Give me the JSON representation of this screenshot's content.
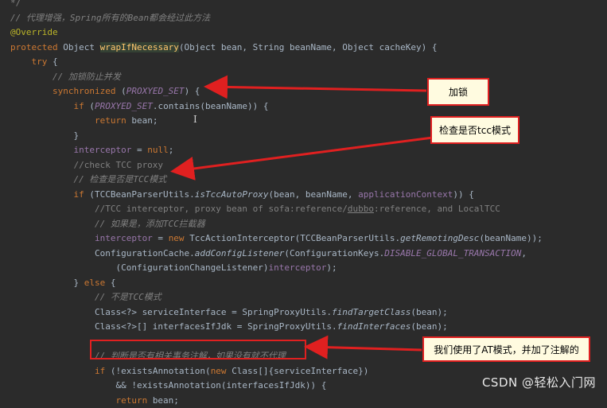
{
  "code_lines": [
    {
      "id": "l0",
      "segs": [
        {
          "c": "cm",
          "t": "*/"
        }
      ]
    },
    {
      "id": "l1",
      "segs": [
        {
          "c": "cmi",
          "t": "// 代理增强，Spring所有的Bean都会经过此方法"
        }
      ]
    },
    {
      "id": "l2",
      "segs": [
        {
          "c": "ann",
          "t": "@Override"
        }
      ]
    },
    {
      "id": "l3",
      "segs": [
        {
          "c": "kw",
          "t": "protected "
        },
        {
          "c": "tok",
          "t": "Object "
        },
        {
          "c": "fnh",
          "t": "wrapIfNecessary"
        },
        {
          "c": "tok",
          "t": "(Object bean, String beanName, Object cacheKey) {"
        }
      ]
    },
    {
      "id": "l4",
      "segs": [
        {
          "c": "kw",
          "t": "    try "
        },
        {
          "c": "tok",
          "t": "{"
        }
      ]
    },
    {
      "id": "l5",
      "segs": [
        {
          "c": "cmi",
          "t": "        // 加锁防止并发"
        }
      ]
    },
    {
      "id": "l6",
      "segs": [
        {
          "c": "kw",
          "t": "        synchronized "
        },
        {
          "c": "tok",
          "t": "("
        },
        {
          "c": "cst",
          "t": "PROXYED_SET"
        },
        {
          "c": "tok",
          "t": ") {"
        }
      ]
    },
    {
      "id": "l7",
      "segs": [
        {
          "c": "kw",
          "t": "            if "
        },
        {
          "c": "tok",
          "t": "("
        },
        {
          "c": "cst",
          "t": "PROXYED_SET"
        },
        {
          "c": "tok",
          "t": ".contains(beanName)) {"
        }
      ]
    },
    {
      "id": "l8",
      "segs": [
        {
          "c": "kw",
          "t": "                return "
        },
        {
          "c": "tok",
          "t": "bean;"
        }
      ]
    },
    {
      "id": "l9",
      "segs": [
        {
          "c": "tok",
          "t": "            }"
        }
      ]
    },
    {
      "id": "l10",
      "segs": [
        {
          "c": "prm",
          "t": "            interceptor"
        },
        {
          "c": "tok",
          "t": " = "
        },
        {
          "c": "kw",
          "t": "null"
        },
        {
          "c": "tok",
          "t": ";"
        }
      ]
    },
    {
      "id": "l11",
      "segs": [
        {
          "c": "cm",
          "t": "            //check TCC proxy"
        }
      ]
    },
    {
      "id": "l12",
      "segs": [
        {
          "c": "cmi",
          "t": "            // 检查是否是TCC模式"
        }
      ]
    },
    {
      "id": "l13",
      "segs": [
        {
          "c": "kw",
          "t": "            if "
        },
        {
          "c": "tok",
          "t": "(TCCBeanParserUtils."
        },
        {
          "c": "sti",
          "t": "isTccAutoProxy"
        },
        {
          "c": "tok",
          "t": "(bean, beanName, "
        },
        {
          "c": "prm",
          "t": "applicationContext"
        },
        {
          "c": "tok",
          "t": ")) {"
        }
      ]
    },
    {
      "id": "l14",
      "segs": [
        {
          "c": "cm",
          "t": "                //TCC interceptor, proxy bean of sofa:reference/"
        },
        {
          "c": "cm und",
          "t": "dubbo"
        },
        {
          "c": "cm",
          "t": ":reference, and LocalTCC"
        }
      ]
    },
    {
      "id": "l15",
      "segs": [
        {
          "c": "cmi",
          "t": "                // 如果是，添加TCC拦截器"
        }
      ]
    },
    {
      "id": "l16",
      "segs": [
        {
          "c": "prm",
          "t": "                interceptor"
        },
        {
          "c": "tok",
          "t": " = "
        },
        {
          "c": "kw",
          "t": "new "
        },
        {
          "c": "tok",
          "t": "TccActionInterceptor(TCCBeanParserUtils."
        },
        {
          "c": "sti",
          "t": "getRemotingDesc"
        },
        {
          "c": "tok",
          "t": "(beanName));"
        }
      ]
    },
    {
      "id": "l17",
      "segs": [
        {
          "c": "tok",
          "t": "                ConfigurationCache."
        },
        {
          "c": "sti",
          "t": "addConfigListener"
        },
        {
          "c": "tok",
          "t": "(ConfigurationKeys."
        },
        {
          "c": "cst",
          "t": "DISABLE_GLOBAL_TRANSACTION"
        },
        {
          "c": "tok",
          "t": ","
        }
      ]
    },
    {
      "id": "l18",
      "segs": [
        {
          "c": "tok",
          "t": "                    (ConfigurationChangeListener)"
        },
        {
          "c": "prm",
          "t": "interceptor"
        },
        {
          "c": "tok",
          "t": ");"
        }
      ]
    },
    {
      "id": "l19",
      "segs": [
        {
          "c": "tok",
          "t": "            } "
        },
        {
          "c": "kw",
          "t": "else "
        },
        {
          "c": "tok",
          "t": "{"
        }
      ]
    },
    {
      "id": "l20",
      "segs": [
        {
          "c": "cmi",
          "t": "                // 不是TCC模式"
        }
      ]
    },
    {
      "id": "l21",
      "segs": [
        {
          "c": "tok",
          "t": "                Class<?> serviceInterface = SpringProxyUtils."
        },
        {
          "c": "sti",
          "t": "findTargetClass"
        },
        {
          "c": "tok",
          "t": "(bean);"
        }
      ]
    },
    {
      "id": "l22",
      "segs": [
        {
          "c": "tok",
          "t": "                Class<?>[] interfacesIfJdk = SpringProxyUtils."
        },
        {
          "c": "sti",
          "t": "findInterfaces"
        },
        {
          "c": "tok",
          "t": "(bean);"
        }
      ]
    },
    {
      "id": "l23",
      "segs": [
        {
          "c": "tok",
          "t": ""
        }
      ]
    },
    {
      "id": "l24",
      "segs": [
        {
          "c": "cmi",
          "t": "                // 判断是否有相关事务注解，如果没有就不代理"
        }
      ]
    },
    {
      "id": "l25",
      "segs": [
        {
          "c": "kw",
          "t": "                if "
        },
        {
          "c": "tok",
          "t": "(!existsAnnotation("
        },
        {
          "c": "kw",
          "t": "new "
        },
        {
          "c": "tok",
          "t": "Class[]{serviceInterface})"
        }
      ]
    },
    {
      "id": "l26",
      "segs": [
        {
          "c": "tok",
          "t": "                    && !existsAnnotation(interfacesIfJdk)) {"
        }
      ]
    },
    {
      "id": "l27",
      "segs": [
        {
          "c": "kw",
          "t": "                    return "
        },
        {
          "c": "tok",
          "t": "bean;"
        }
      ]
    }
  ],
  "callouts": {
    "lock": "加锁",
    "tcc_check": "检查是否tcc模式",
    "at_mode": "我们使用了AT模式，并加了注解的"
  },
  "watermark": "CSDN @轻松入门网",
  "colors": {
    "background": "#2b2b2b",
    "keyword": "#cc7832",
    "comment": "#808080",
    "annotation_border": "#e02020",
    "callout_bg": "#fffbe0"
  }
}
